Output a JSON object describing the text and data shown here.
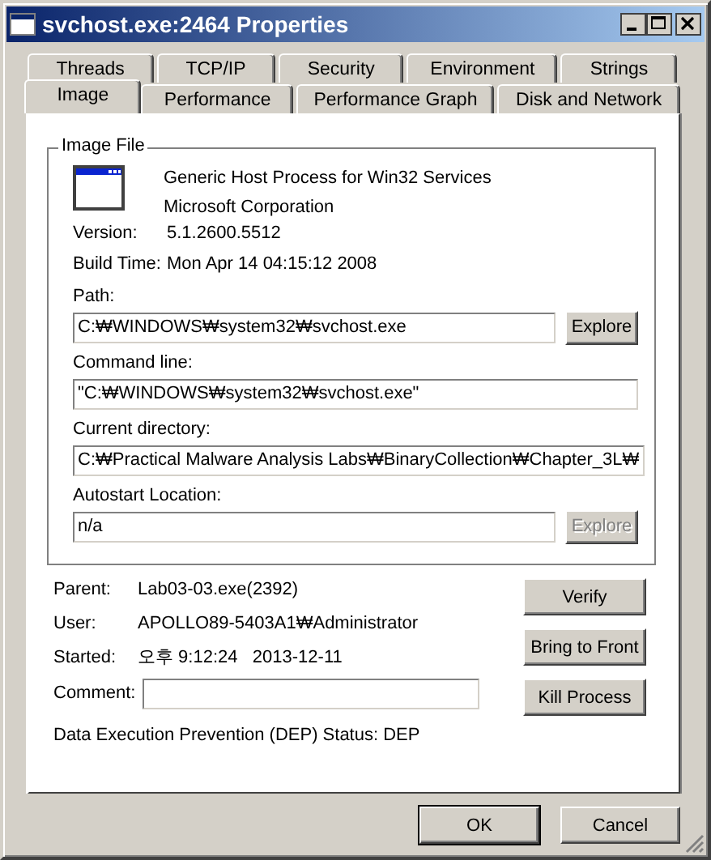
{
  "window": {
    "title": "svchost.exe:2464 Properties"
  },
  "tab_rows": [
    {
      "tabs": [
        {
          "label": "Threads",
          "selected": false
        },
        {
          "label": "TCP/IP",
          "selected": false
        },
        {
          "label": "Security",
          "selected": false
        },
        {
          "label": "Environment",
          "selected": false
        },
        {
          "label": "Strings",
          "selected": false
        }
      ]
    },
    {
      "tabs": [
        {
          "label": "Image",
          "selected": true
        },
        {
          "label": "Performance",
          "selected": false
        },
        {
          "label": "Performance Graph",
          "selected": false
        },
        {
          "label": "Disk and Network",
          "selected": false
        }
      ]
    }
  ],
  "image_file": {
    "title": "Image File",
    "description": "Generic Host Process for Win32 Services",
    "company": "Microsoft Corporation",
    "details": [
      {
        "label": "Version:",
        "value": "5.1.2600.5512"
      },
      {
        "label": "Build Time:",
        "value": "Mon Apr 14 04:15:12 2008"
      }
    ],
    "fields": [
      {
        "label": "Path:",
        "value": "C:₩WINDOWS₩system32₩svchost.exe",
        "button": {
          "label": "Explore",
          "disabled": false
        }
      },
      {
        "label": "Command line:",
        "value": "\"C:₩WINDOWS₩system32₩svchost.exe\""
      },
      {
        "label": "Current directory:",
        "value": "C:₩Practical Malware Analysis Labs₩BinaryCollection₩Chapter_3L₩"
      },
      {
        "label": "Autostart Location:",
        "value": "n/a",
        "button": {
          "label": "Explore",
          "disabled": true
        }
      }
    ]
  },
  "process": {
    "info": [
      {
        "label": "Parent:",
        "value": "Lab03-03.exe(2392)"
      },
      {
        "label": "User:",
        "value": "APOLLO89-5403A1₩Administrator"
      },
      {
        "label": "Started:",
        "value": "오후 9:12:24   2013-12-11"
      }
    ],
    "comment": {
      "label": "Comment:"
    },
    "dep": "Data Execution Prevention (DEP) Status: DEP",
    "buttons": [
      {
        "label": "Verify"
      },
      {
        "label": "Bring to Front"
      },
      {
        "label": "Kill Process"
      }
    ]
  },
  "dialog_buttons": [
    {
      "label": "OK",
      "default": true
    },
    {
      "label": "Cancel",
      "default": false
    }
  ]
}
